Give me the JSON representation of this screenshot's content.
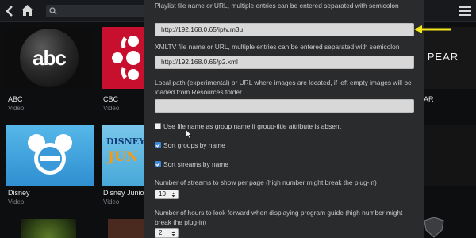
{
  "background_app": {
    "top_bar": {
      "icons": [
        "back-icon",
        "home-icon",
        "search-icon",
        "menu-icon"
      ]
    },
    "channels": [
      {
        "logo_text": "abc",
        "name": "ABC",
        "type": "Video"
      },
      {
        "name": "CBC",
        "type": "Video"
      },
      {
        "name": "Disney",
        "type": "Video"
      },
      {
        "logo_text_1": "DISNEY",
        "logo_text_2": "JUN",
        "name": "Disney Junior",
        "type": "Video"
      },
      {
        "logo_text": "el PEAR",
        "name": "AR"
      }
    ]
  },
  "dialog": {
    "playlist_label": "Playlist file name or URL, multiple entries can be entered separated with semicolon",
    "playlist_value": "http://192.168.0.65/iptv.m3u",
    "xmltv_label": "XMLTV file name or URL, multiple entries can be entered separated with semicolon",
    "xmltv_value": "http://192.168.0.65/p2.xml",
    "local_path_label": "Local path (experimental) or URL where images are located, if left empty images will be loaded from Resources folder",
    "local_path_value": "",
    "checkboxes": [
      {
        "label": "Use file name as group name if group-title attribute is absent",
        "checked": false
      },
      {
        "label": "Sort groups by name",
        "checked": true
      },
      {
        "label": "Sort streams by name",
        "checked": true
      }
    ],
    "streams_per_page_label": "Number of streams to show per page (high number might break the plug-in)",
    "streams_per_page_value": "10",
    "hours_forward_label": "Number of hours to look forward when displaying program guide (high number might break the plug-in)",
    "hours_forward_value": "2"
  },
  "colors": {
    "checkbox_on": "#3a86d8",
    "arrow": "#f5e61a",
    "dialog_bg": "#2a2b2c",
    "field_bg": "#d8d8d8"
  }
}
